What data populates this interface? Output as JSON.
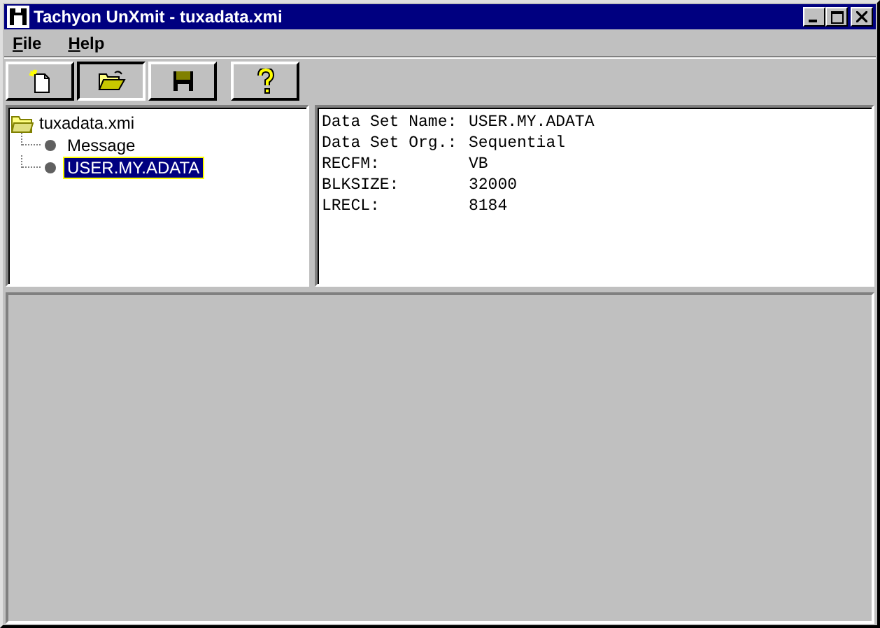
{
  "window": {
    "title": "Tachyon UnXmit - tuxadata.xmi"
  },
  "menu": [
    {
      "label": "File"
    },
    {
      "label": "Help"
    }
  ],
  "toolbar": [
    {
      "kind": "new",
      "pressed": false
    },
    {
      "kind": "open",
      "pressed": true
    },
    {
      "kind": "save",
      "pressed": false
    },
    {
      "kind": "help",
      "pressed": false
    }
  ],
  "tree": {
    "label": "tuxadata.xmi",
    "children": [
      {
        "label": "Message",
        "selected": false
      },
      {
        "label": "USER.MY.ADATA",
        "selected": true
      }
    ]
  },
  "details": [
    {
      "label": "Data Set Name:",
      "value": "USER.MY.ADATA"
    },
    {
      "label": "Data Set Org.:",
      "value": "Sequential"
    },
    {
      "label": "RECFM:",
      "value": "VB"
    },
    {
      "label": "BLKSIZE:",
      "value": "32000"
    },
    {
      "label": "LRECL:",
      "value": "8184"
    }
  ]
}
